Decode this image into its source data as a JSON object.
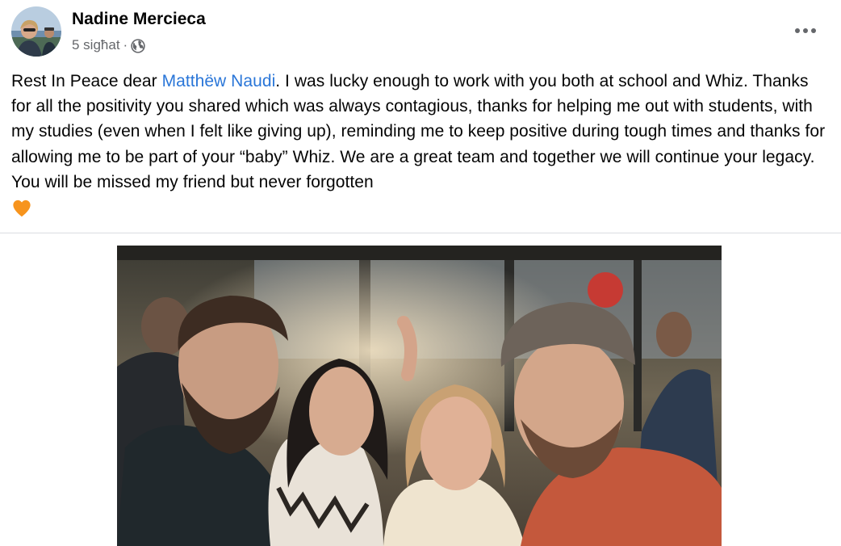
{
  "post": {
    "author": "Nadine Mercieca",
    "timestamp": "5 sigħat",
    "separator": "·",
    "privacy_icon": "globe-icon",
    "more_icon": "more-options-icon",
    "text": {
      "before_mention": "Rest In Peace dear ",
      "mention": "Matthëw Naudi",
      "after_mention": ". I was lucky enough to work with you both at school and Whiz. Thanks for all the positivity you shared which was always contagious, thanks for helping me out with students, with my studies (even when I felt like giving up), reminding me to keep positive during tough times and thanks for allowing me to be part of your “baby” Whiz. We are a great team and together we will continue your legacy. You will be missed my friend but never forgotten",
      "emoji": "orange-heart-icon"
    },
    "photo": "group-selfie-photo"
  },
  "colors": {
    "mention": "#2a76d8",
    "secondary_text": "#65676b",
    "divider": "#dadde1",
    "heart": "#f7941d"
  }
}
